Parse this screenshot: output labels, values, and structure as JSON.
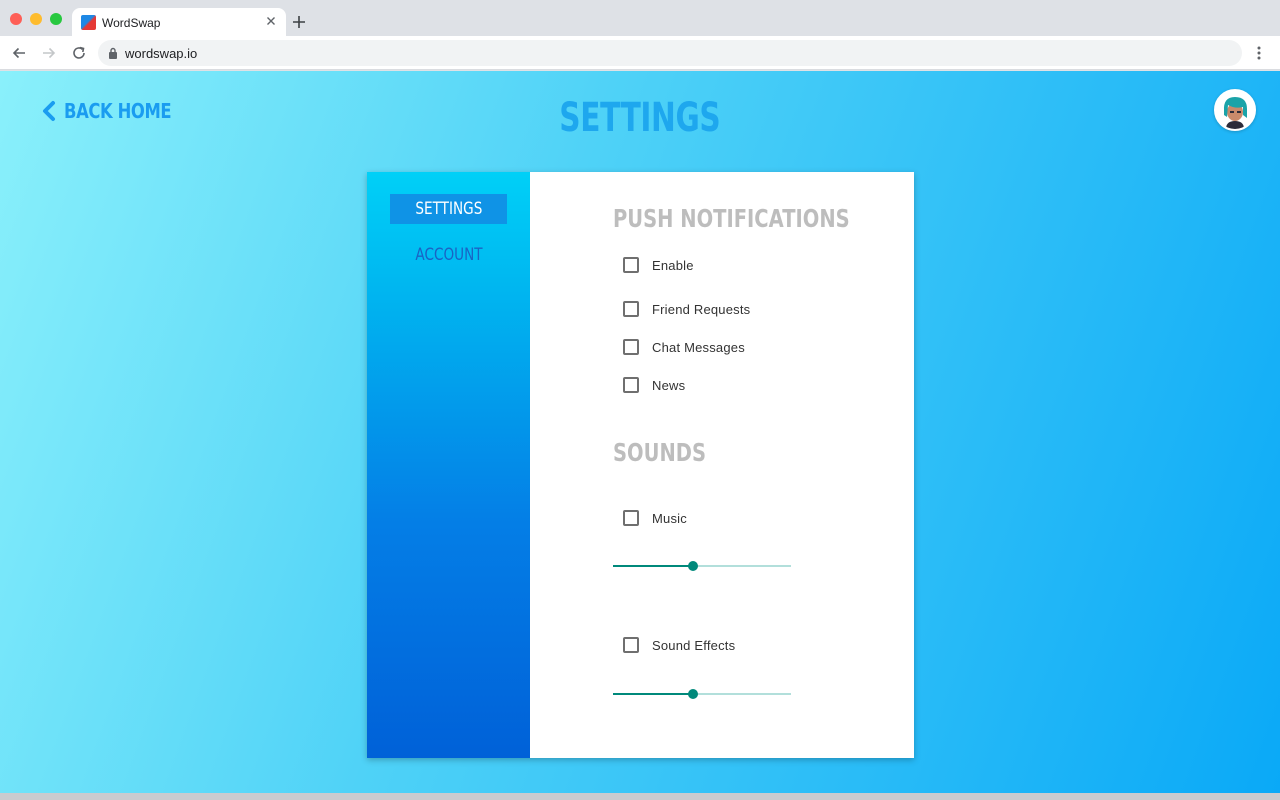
{
  "browser": {
    "tab_title": "WordSwap",
    "url": "wordswap.io"
  },
  "page": {
    "back_link": "BACK HOME",
    "title": "SETTINGS"
  },
  "sidebar": {
    "items": [
      {
        "label": "SETTINGS",
        "active": true
      },
      {
        "label": "ACCOUNT",
        "active": false
      }
    ]
  },
  "push_notifications": {
    "heading": "PUSH NOTIFICATIONS",
    "options": [
      {
        "label": "Enable",
        "checked": false
      },
      {
        "label": "Friend Requests",
        "checked": false
      },
      {
        "label": "Chat Messages",
        "checked": false
      },
      {
        "label": "News",
        "checked": false
      }
    ]
  },
  "sounds": {
    "heading": "SOUNDS",
    "music": {
      "label": "Music",
      "checked": false,
      "volume_percent": 45
    },
    "sound_effects": {
      "label": "Sound Effects",
      "checked": false,
      "volume_percent": 45
    }
  },
  "colors": {
    "accent": "#1ea7ee",
    "slider": "#00897b",
    "heading_gray": "#bdbdbd"
  }
}
